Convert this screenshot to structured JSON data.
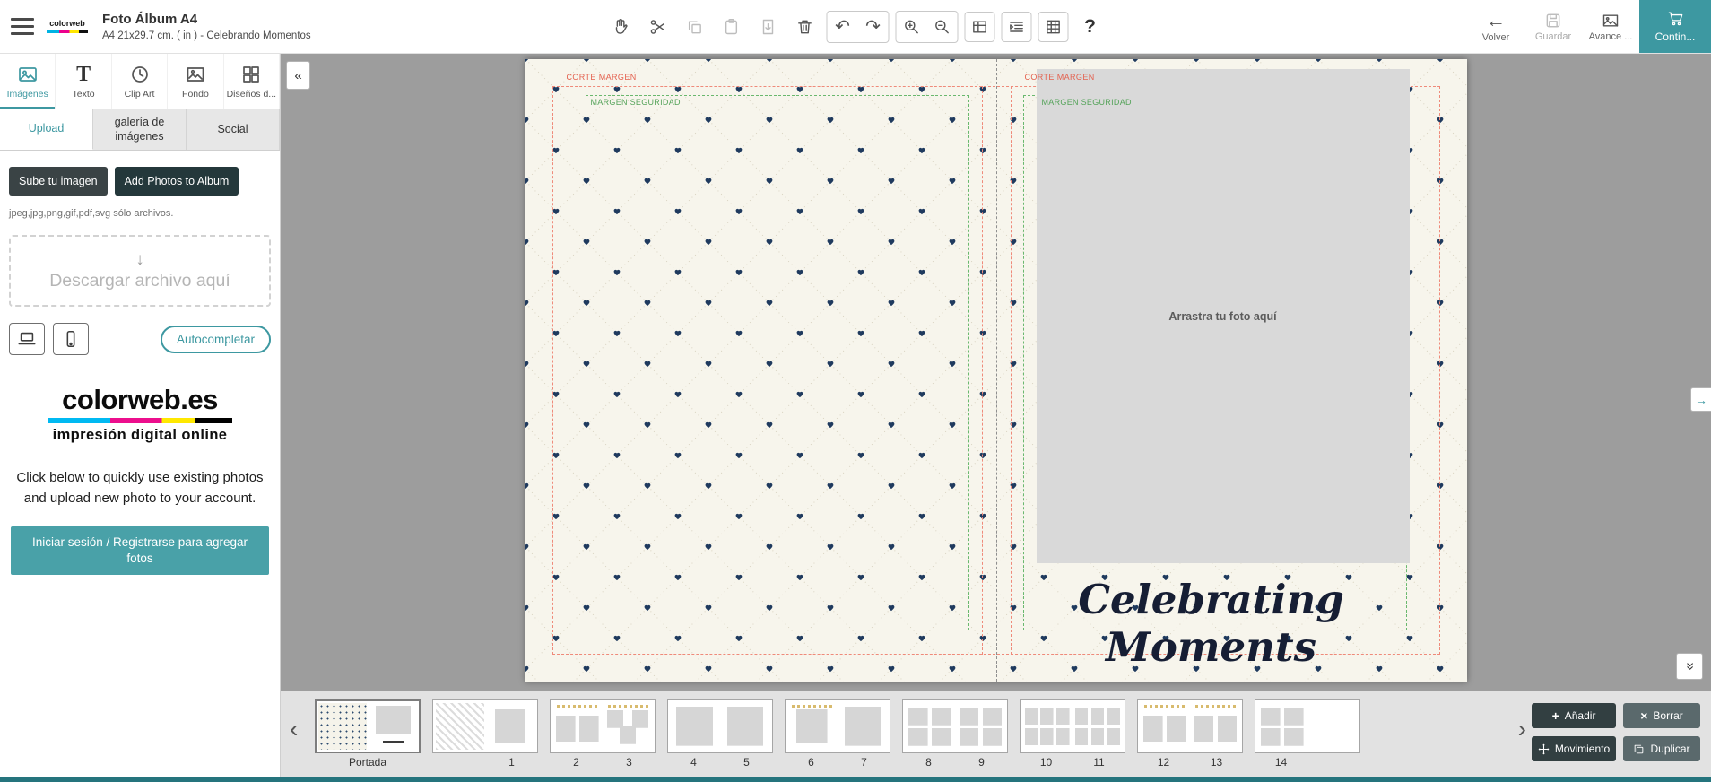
{
  "glyphs": {
    "undo": "↶",
    "redo": "↷",
    "back_arrow": "←",
    "down_arrow": "↓",
    "collapse_left": "«",
    "prev": "‹",
    "next": "›",
    "expand_right": "→",
    "double_down": "»",
    "plus": "+",
    "close": "×",
    "help": "?",
    "text_tool": "T"
  },
  "header": {
    "brand_mini": "colorweb",
    "title": "Foto Álbum A4",
    "subtitle": "A4 21x29.7 cm.  ( in )  - Celebrando Momentos",
    "volver_label": "Volver",
    "guardar_label": "Guardar",
    "avance_label": "Avance ...",
    "continue_label": "Contin..."
  },
  "sidebar": {
    "tools": [
      {
        "label": "Imágenes"
      },
      {
        "label": "Texto"
      },
      {
        "label": "Clip Art"
      },
      {
        "label": "Fondo"
      },
      {
        "label": "Diseños d..."
      }
    ],
    "tabs": [
      {
        "label": "Upload"
      },
      {
        "label": "galería de imágenes"
      },
      {
        "label": "Social"
      }
    ],
    "upload_button": "Sube tu imagen",
    "add_photos_button": "Add Photos to Album",
    "filetypes_note": "jpeg,jpg,png,gif,pdf,svg sólo archivos.",
    "dropzone_label": "Descargar archivo aquí",
    "autocomplete_button": "Autocompletar",
    "brand_name": "colorweb.es",
    "brand_tagline": "impresión digital online",
    "info_text": "Click below to quickly use existing photos and upload new photo to your account.",
    "signin_button": "Iniciar sesión / Registrarse para agregar fotos"
  },
  "canvas": {
    "cut_margin_left": "CORTE MARGEN",
    "cut_margin_right": "CORTE MARGEN",
    "safe_margin_left": "MARGEN SEGURIDAD",
    "safe_margin_right": "MARGEN SEGURIDAD",
    "photo_placeholder": "Arrastra tu foto aquí",
    "cover_title": "Celebrating Moments"
  },
  "filmstrip": {
    "items": [
      {
        "caption": "Portada",
        "left": "",
        "right": ""
      },
      {
        "caption": "",
        "left": "",
        "right": "1"
      },
      {
        "caption": "",
        "left": "2",
        "right": "3"
      },
      {
        "caption": "",
        "left": "4",
        "right": "5"
      },
      {
        "caption": "",
        "left": "6",
        "right": "7"
      },
      {
        "caption": "",
        "left": "8",
        "right": "9"
      },
      {
        "caption": "",
        "left": "10",
        "right": "11"
      },
      {
        "caption": "",
        "left": "12",
        "right": "13"
      },
      {
        "caption": "",
        "left": "14",
        "right": ""
      }
    ],
    "add_button": "Añadir",
    "delete_button": "Borrar",
    "move_button": "Movimiento",
    "duplicate_button": "Duplicar"
  }
}
